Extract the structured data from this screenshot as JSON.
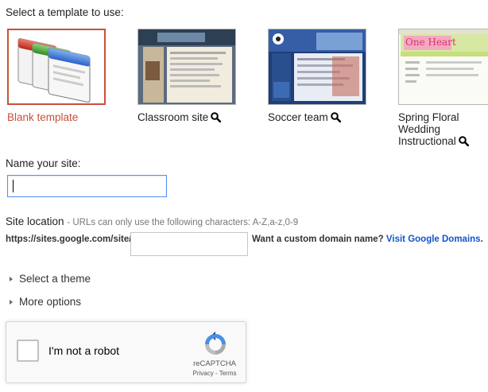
{
  "templates_heading": "Select a template to use:",
  "templates": [
    {
      "label": "Blank template",
      "selected": true,
      "preview": false
    },
    {
      "label": "Classroom site",
      "selected": false,
      "preview": true
    },
    {
      "label": "Soccer team",
      "selected": false,
      "preview": true
    },
    {
      "label_lines": [
        "Spring Floral",
        "Wedding",
        "Instructional"
      ],
      "selected": false,
      "preview": true
    }
  ],
  "thumb_texts": {
    "spring_banner": "One Heart"
  },
  "name": {
    "label": "Name your site:",
    "value": ""
  },
  "location": {
    "label": "Site location",
    "hint": "- URLs can only use the following characters: A-Z,a-z,0-9",
    "prefix": "https://sites.google.com/site/",
    "value": "",
    "custom_domain_question": "Want a custom domain name?",
    "custom_domain_link": "Visit Google Domains",
    "period": "."
  },
  "expanders": {
    "theme": "Select a theme",
    "more": "More options"
  },
  "captcha": {
    "label": "I'm not a robot",
    "brand": "reCAPTCHA",
    "privacy": "Privacy",
    "sep": " - ",
    "terms": "Terms"
  },
  "colors": {
    "selected_accent": "#c9503a",
    "link": "#1155cc",
    "focus": "#4d90fe"
  },
  "icons": [
    "magnifier-icon",
    "triangle-right-icon",
    "recaptcha-logo-icon"
  ]
}
